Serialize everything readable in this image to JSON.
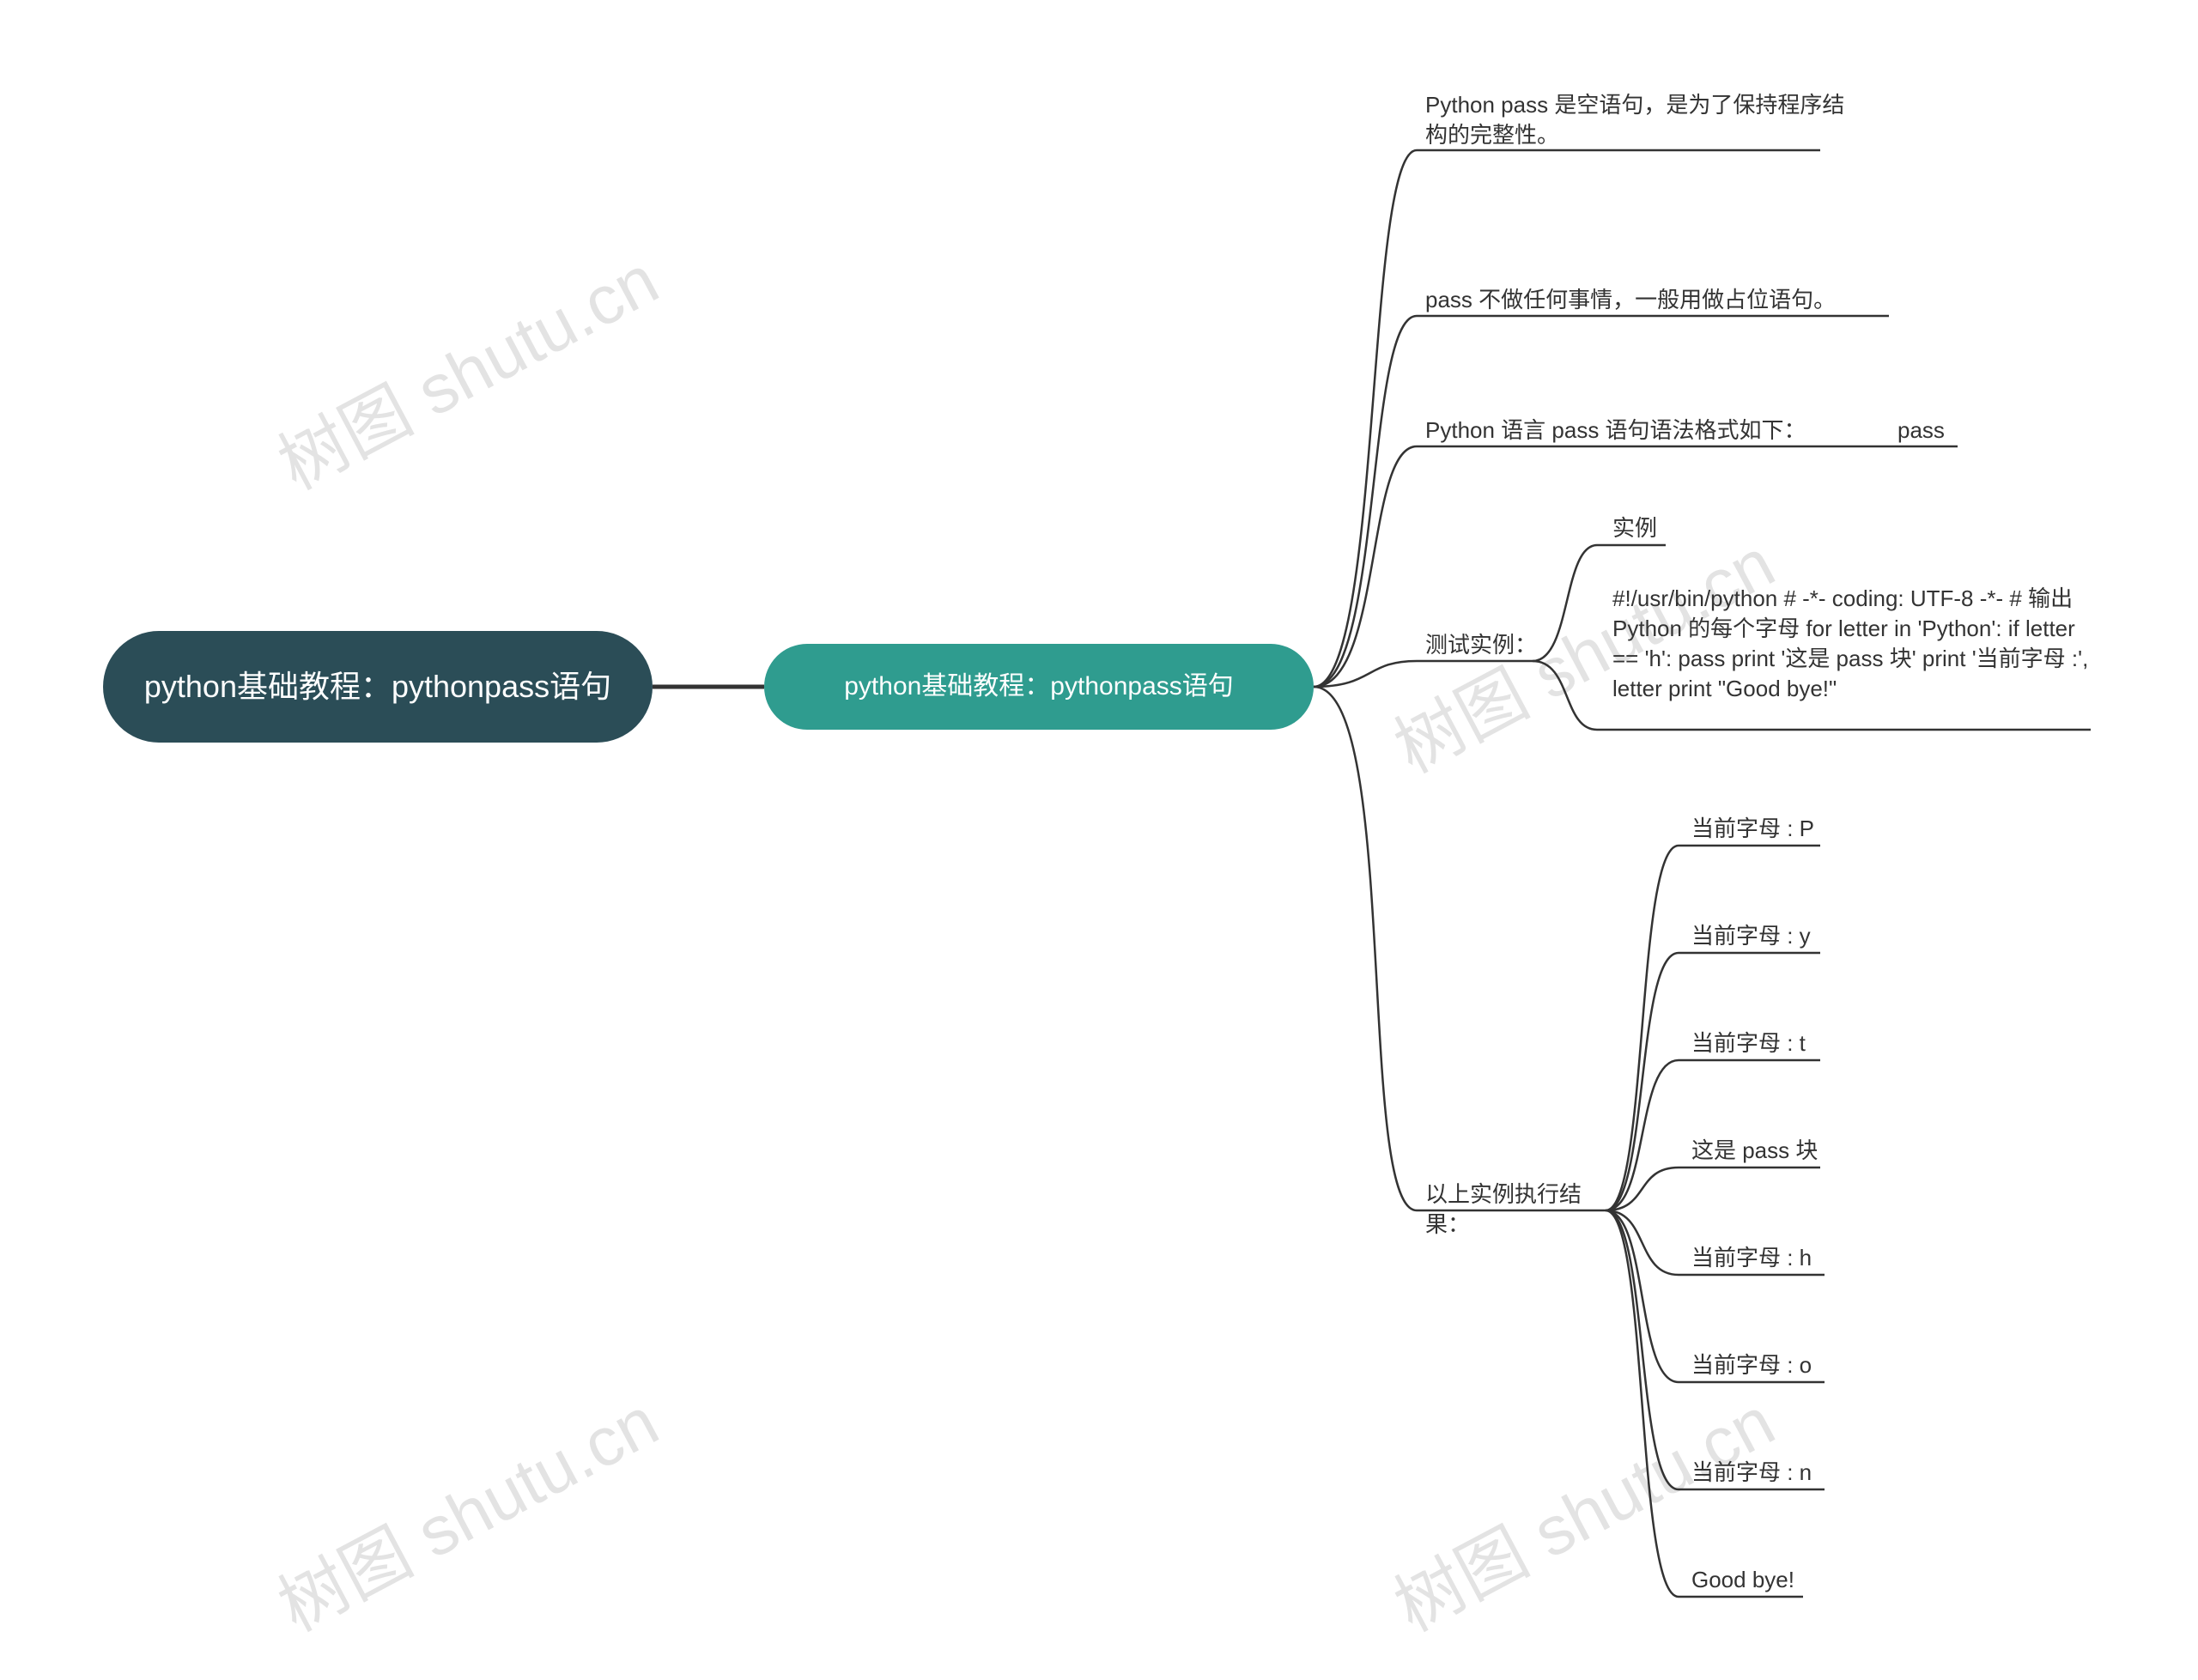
{
  "watermark_text": "树图 shutu.cn",
  "root": {
    "title": "python基础教程：pythonpass语句"
  },
  "level1": {
    "title": "python基础教程：pythonpass语句"
  },
  "children": {
    "c1": "Python pass 是空语句，是为了保持程序结构的完整性。",
    "c2": "pass 不做任何事情，一般用做占位语句。",
    "c3": "Python 语言 pass 语句语法格式如下：",
    "c3_child": "pass",
    "c4": "测试实例：",
    "c4_children": {
      "a": "实例",
      "b": "#!/usr/bin/python # -*- coding: UTF-8 -*- # 输出 Python 的每个字母 for letter in 'Python': if letter == 'h': pass print '这是 pass 块' print '当前字母 :', letter print \"Good bye!\""
    },
    "c5": "以上实例执行结果：",
    "c5_children": {
      "r1": "当前字母 : P",
      "r2": "当前字母 : y",
      "r3": "当前字母 : t",
      "r4": "这是 pass 块",
      "r5": "当前字母 : h",
      "r6": "当前字母 : o",
      "r7": "当前字母 : n",
      "r8": "Good bye!"
    }
  }
}
